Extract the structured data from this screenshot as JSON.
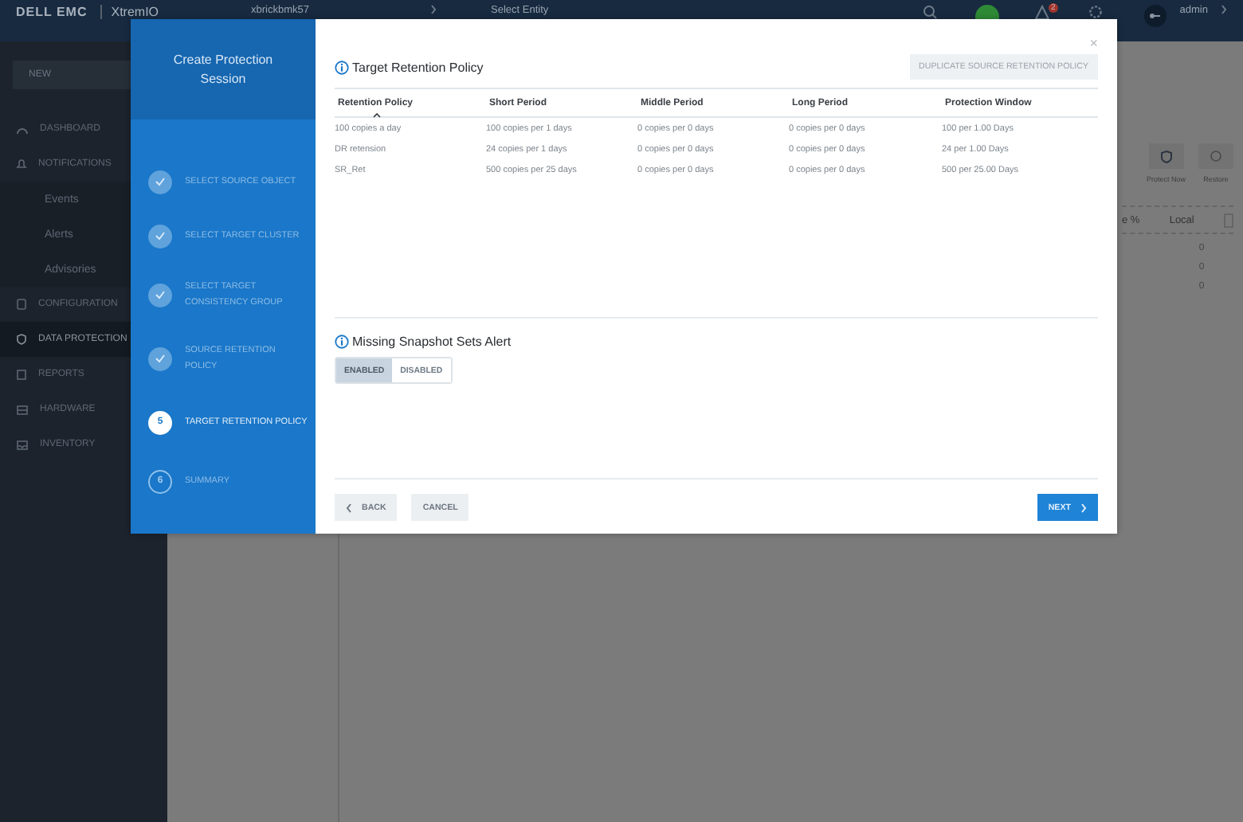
{
  "top_bar": {
    "brand_primary": "DELL EMC",
    "brand_secondary": "XtremIO",
    "cluster": "xbrickbmk57",
    "entity_select": "Select Entity",
    "notification_count": "2",
    "user": "admin"
  },
  "sidebar": {
    "new_button": "NEW",
    "items": [
      {
        "label": "DASHBOARD",
        "selected": false
      },
      {
        "label": "NOTIFICATIONS",
        "selected": false,
        "children": [
          {
            "label": "Events",
            "selected": false
          },
          {
            "label": "Alerts",
            "selected": false
          },
          {
            "label": "Advisories",
            "selected": false
          }
        ]
      },
      {
        "label": "CONFIGURATION",
        "selected": false
      },
      {
        "label": "DATA PROTECTION",
        "selected": true
      },
      {
        "label": "REPORTS",
        "selected": false
      },
      {
        "label": "HARDWARE",
        "selected": false
      },
      {
        "label": "INVENTORY",
        "selected": false
      }
    ]
  },
  "main": {
    "toolbar": [
      {
        "label": "Protect Now"
      },
      {
        "label": "Restore"
      }
    ],
    "table": {
      "columns": [
        "e %",
        "Local"
      ],
      "rows": [
        {
          "local": "0"
        },
        {
          "local": "0"
        },
        {
          "local": "0"
        }
      ]
    }
  },
  "dialog": {
    "title": "Create Protection Session",
    "steps": [
      {
        "label": "SELECT SOURCE OBJECT",
        "completed": true,
        "selected": false
      },
      {
        "label": "SELECT TARGET CLUSTER",
        "completed": true,
        "selected": false
      },
      {
        "label": "SELECT TARGET CONSISTENCY GROUP",
        "completed": true,
        "selected": false
      },
      {
        "label": "SOURCE RETENTION POLICY",
        "completed": true,
        "selected": false
      },
      {
        "number": "5",
        "label": "TARGET RETENTION POLICY",
        "completed": false,
        "selected": true
      },
      {
        "number": "6",
        "label": "SUMMARY",
        "completed": false,
        "selected": false
      }
    ],
    "close": "×",
    "section_title": "Target Retention Policy",
    "duplicate_button": "DUPLICATE SOURCE RETENTION POLICY",
    "table": {
      "columns": [
        "Retention Policy",
        "Short Period",
        "Middle Period",
        "Long Period",
        "Protection Window"
      ],
      "rows": [
        [
          "100 copies a day",
          "100 copies per 1 days",
          "0 copies per 0 days",
          "0 copies per 0 days",
          "100 per 1.00 Days"
        ],
        [
          "DR retension",
          "24 copies per 1 days",
          "0 copies per 0 days",
          "0 copies per 0 days",
          "24 per 1.00 Days"
        ],
        [
          "SR_Ret",
          "500 copies per 25 days",
          "0 copies per 0 days",
          "0 copies per 0 days",
          "500 per 25.00 Days"
        ]
      ]
    },
    "alert_title": "Missing Snapshot Sets Alert",
    "alert_options": [
      {
        "label": "ENABLED",
        "selected": true
      },
      {
        "label": "DISABLED",
        "selected": false
      }
    ],
    "buttons": {
      "back": "BACK",
      "cancel": "CANCEL",
      "next": "NEXT"
    }
  }
}
